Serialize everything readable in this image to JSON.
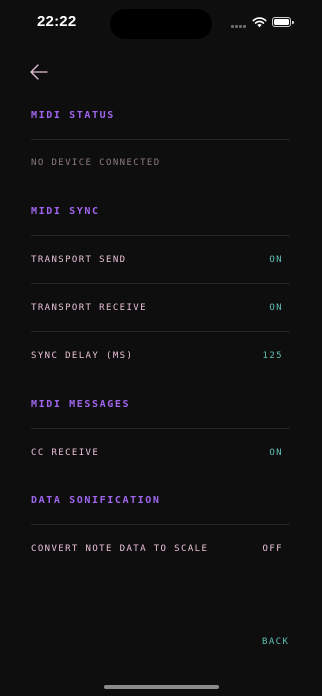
{
  "status_bar": {
    "time": "22:22"
  },
  "sections": {
    "midi_status": {
      "header": "MIDI STATUS",
      "status_text": "NO DEVICE CONNECTED"
    },
    "midi_sync": {
      "header": "MIDI SYNC",
      "rows": [
        {
          "label": "TRANSPORT SEND",
          "value": "ON"
        },
        {
          "label": "TRANSPORT RECEIVE",
          "value": "ON"
        },
        {
          "label": "SYNC DELAY (MS)",
          "value": "125"
        }
      ]
    },
    "midi_messages": {
      "header": "MIDI MESSAGES",
      "rows": [
        {
          "label": "CC RECEIVE",
          "value": "ON"
        }
      ]
    },
    "data_sonification": {
      "header": "DATA SONIFICATION",
      "rows": [
        {
          "label": "CONVERT NOTE DATA TO SCALE",
          "value": "OFF"
        }
      ]
    }
  },
  "footer": {
    "back_label": "BACK"
  },
  "colors": {
    "background": "#0e0e0e",
    "section_header": "#a066f0",
    "row_label": "#e9c1d6",
    "value_on": "#5ec0b4",
    "value_off": "#e9c1d6",
    "muted_status": "#8e7a86",
    "divider": "#252525"
  },
  "icons": {
    "back": "arrow-left-icon",
    "wifi": "wifi-icon",
    "battery": "battery-icon",
    "signal": "cellular-signal-icon"
  }
}
